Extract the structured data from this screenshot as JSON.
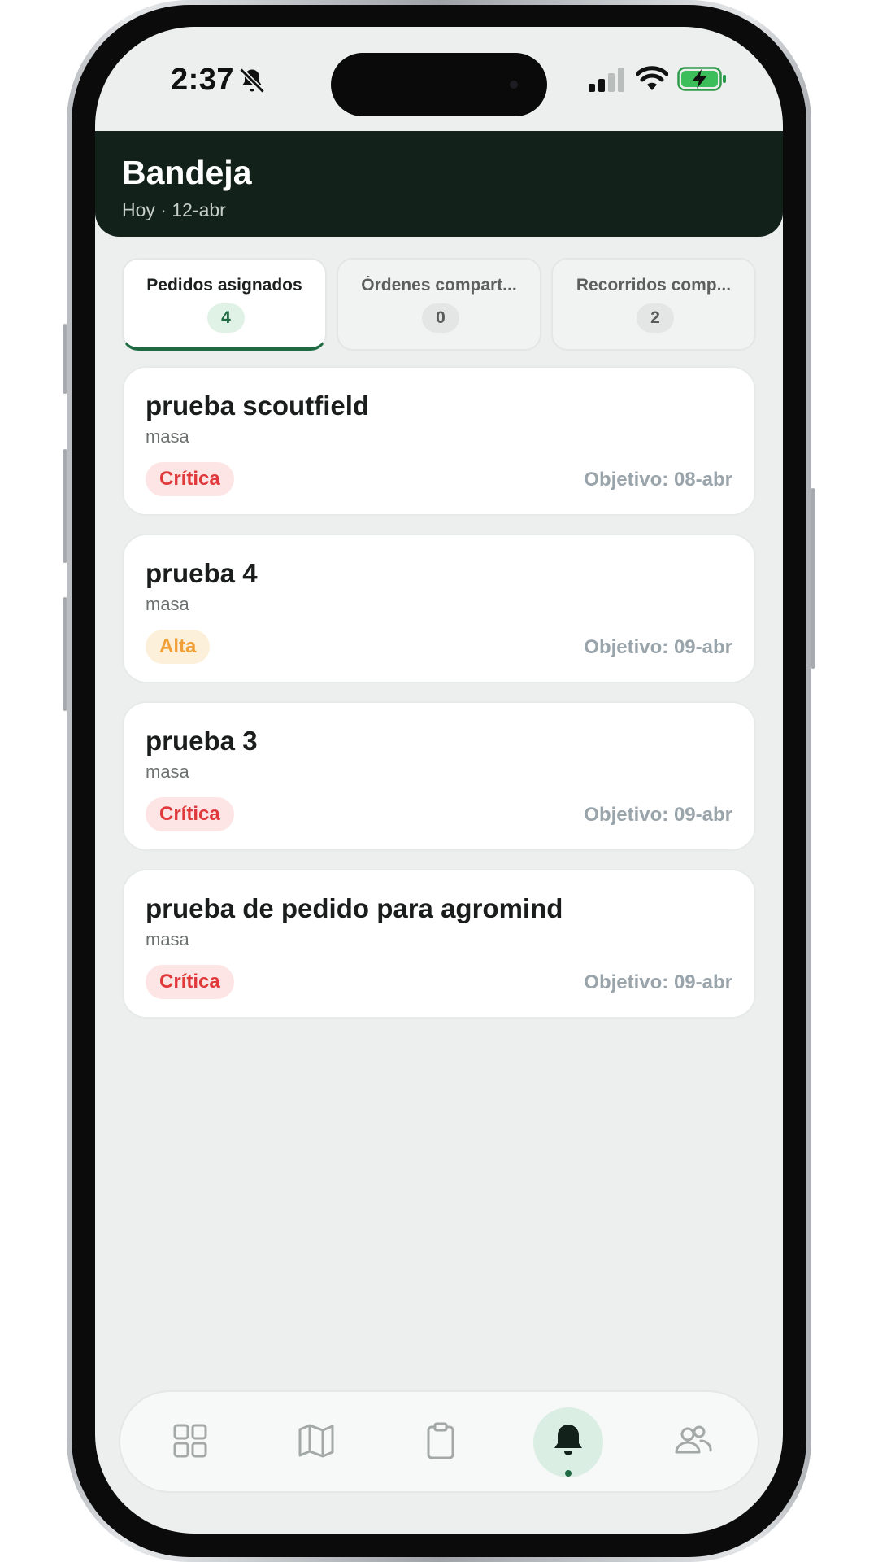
{
  "status_bar": {
    "time": "2:37"
  },
  "header": {
    "title": "Bandeja",
    "subtitle": "Hoy · 12-abr"
  },
  "tabs": [
    {
      "label": "Pedidos asignados",
      "count": "4",
      "active": true
    },
    {
      "label": "Órdenes compart...",
      "count": "0",
      "active": false
    },
    {
      "label": "Recorridos comp...",
      "count": "2",
      "active": false
    }
  ],
  "orders": [
    {
      "title": "prueba scoutfield",
      "subtitle": "masa",
      "priority": "Crítica",
      "goal": "Objetivo: 08-abr"
    },
    {
      "title": "prueba 4",
      "subtitle": "masa",
      "priority": "Alta",
      "goal": "Objetivo: 09-abr"
    },
    {
      "title": "prueba 3",
      "subtitle": "masa",
      "priority": "Crítica",
      "goal": "Objetivo: 09-abr"
    },
    {
      "title": "prueba de pedido para agromind",
      "subtitle": "masa",
      "priority": "Crítica",
      "goal": "Objetivo: 09-abr"
    }
  ],
  "colors": {
    "header_bg": "#13211b",
    "accent_green": "#1f6a43",
    "critical": "#e0393b",
    "high": "#f0a038",
    "screen_bg": "#ecefee"
  },
  "bottom_nav": {
    "items": [
      {
        "icon": "grid-icon"
      },
      {
        "icon": "map-icon"
      },
      {
        "icon": "clipboard-icon"
      },
      {
        "icon": "bell-icon",
        "active": true
      },
      {
        "icon": "users-icon"
      }
    ]
  }
}
